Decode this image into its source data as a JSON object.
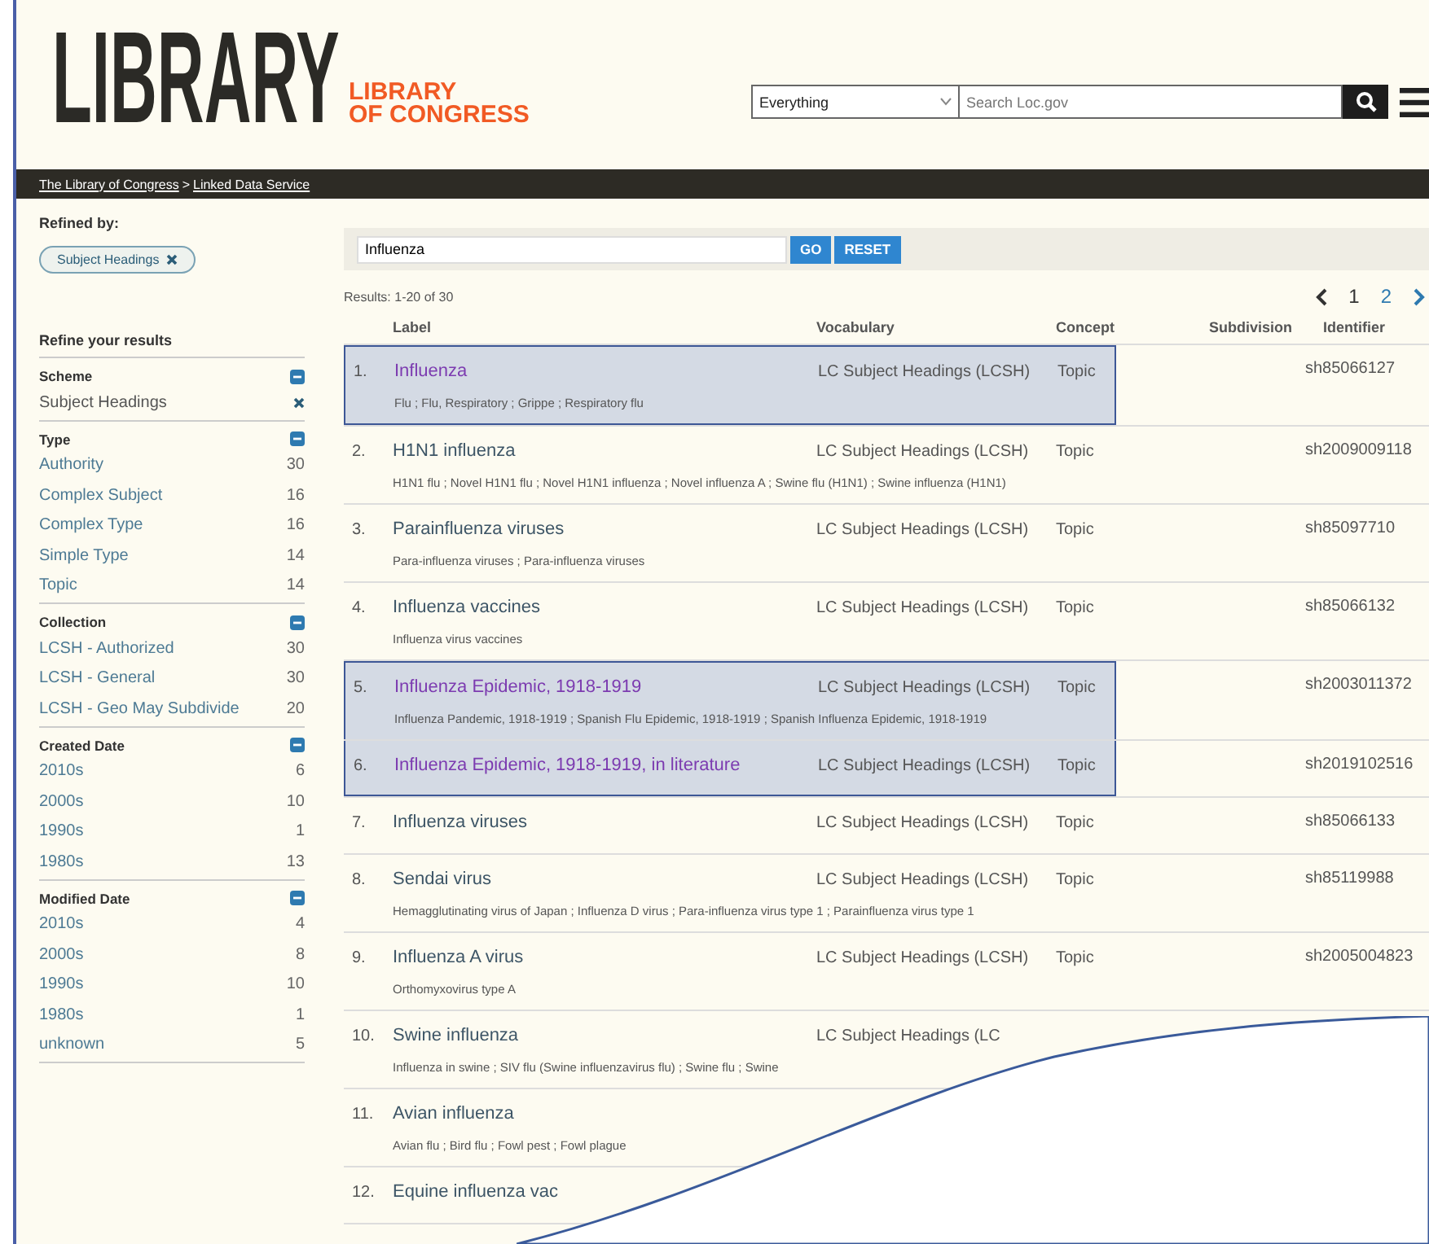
{
  "header": {
    "logo_word": "LIBRARY",
    "logo_sub": [
      "LIBRARY",
      "OF CONGRESS"
    ],
    "scope": "Everything",
    "search_placeholder": "Search Loc.gov"
  },
  "breadcrumb": [
    "The Library of Congress",
    "Linked Data Service"
  ],
  "breadcrumb_sep": ">",
  "sidebar": {
    "refined_title": "Refined by:",
    "chip": "Subject Headings",
    "refine_title": "Refine your results",
    "groups": [
      {
        "title": "Scheme",
        "expanded": true,
        "items": [
          {
            "label": "Subject Headings",
            "kind": "remove"
          }
        ]
      },
      {
        "title": "Type",
        "expanded": true,
        "items": [
          {
            "label": "Authority",
            "count": "30",
            "kind": "count"
          },
          {
            "label": "Complex Subject",
            "count": "16",
            "kind": "count"
          },
          {
            "label": "Complex Type",
            "count": "16",
            "kind": "count"
          },
          {
            "label": "Simple Type",
            "count": "14",
            "kind": "count"
          },
          {
            "label": "Topic",
            "count": "14",
            "kind": "count"
          }
        ]
      },
      {
        "title": "Collection",
        "expanded": true,
        "items": [
          {
            "label": "LCSH - Authorized",
            "count": "30",
            "kind": "count"
          },
          {
            "label": "LCSH - General",
            "count": "30",
            "kind": "count"
          },
          {
            "label": "LCSH - Geo May Subdivide",
            "count": "20",
            "kind": "count"
          }
        ]
      },
      {
        "title": "Created Date",
        "expanded": true,
        "items": [
          {
            "label": "2010s",
            "count": "6",
            "kind": "count"
          },
          {
            "label": "2000s",
            "count": "10",
            "kind": "count"
          },
          {
            "label": "1990s",
            "count": "1",
            "kind": "count"
          },
          {
            "label": "1980s",
            "count": "13",
            "kind": "count"
          }
        ]
      },
      {
        "title": "Modified Date",
        "expanded": true,
        "items": [
          {
            "label": "2010s",
            "count": "4",
            "kind": "count"
          },
          {
            "label": "2000s",
            "count": "8",
            "kind": "count"
          },
          {
            "label": "1990s",
            "count": "10",
            "kind": "count"
          },
          {
            "label": "1980s",
            "count": "1",
            "kind": "count"
          },
          {
            "label": "unknown",
            "count": "5",
            "kind": "count"
          }
        ]
      }
    ]
  },
  "query": {
    "value": "Influenza",
    "go": "GO",
    "reset": "RESET"
  },
  "results_count": "Results: 1-20 of 30",
  "pages": [
    {
      "label": "1",
      "selected": true
    },
    {
      "label": "2",
      "selected": false
    }
  ],
  "table": {
    "columns": [
      "Label",
      "Vocabulary",
      "Concept",
      "Subdivision",
      "Identifier"
    ],
    "rows": [
      {
        "num": "1.",
        "label": "Influenza",
        "vocab": "LC Subject Headings (LCSH)",
        "concept": "Topic",
        "id": "sh85066127",
        "alt": "Flu ; Flu, Respiratory ; Grippe ; Respiratory flu",
        "visited": true,
        "highlighted": true
      },
      {
        "num": "2.",
        "label": "H1N1 influenza",
        "vocab": "LC Subject Headings (LCSH)",
        "concept": "Topic",
        "id": "sh2009009118",
        "alt": "H1N1 flu ; Novel H1N1 flu ; Novel H1N1 influenza ; Novel influenza A ; Swine flu (H1N1) ; Swine influenza (H1N1)",
        "visited": false,
        "highlighted": false
      },
      {
        "num": "3.",
        "label": "Parainfluenza viruses",
        "vocab": "LC Subject Headings (LCSH)",
        "concept": "Topic",
        "id": "sh85097710",
        "alt": "Para-influenza viruses ; Para-influenza viruses",
        "visited": false,
        "highlighted": false
      },
      {
        "num": "4.",
        "label": "Influenza vaccines",
        "vocab": "LC Subject Headings (LCSH)",
        "concept": "Topic",
        "id": "sh85066132",
        "alt": "Influenza virus vaccines",
        "visited": false,
        "highlighted": false
      },
      {
        "num": "5.",
        "label": "Influenza Epidemic, 1918-1919",
        "vocab": "LC Subject Headings (LCSH)",
        "concept": "Topic",
        "id": "sh2003011372",
        "alt": "Influenza Pandemic, 1918-1919 ; Spanish Flu Epidemic, 1918-1919 ; Spanish Influenza Epidemic, 1918-1919",
        "visited": true,
        "highlighted": true
      },
      {
        "num": "6.",
        "label": "Influenza Epidemic, 1918-1919, in literature",
        "vocab": "LC Subject Headings (LCSH)",
        "concept": "Topic",
        "id": "sh2019102516",
        "visited": true,
        "highlighted": true
      },
      {
        "num": "7.",
        "label": "Influenza viruses",
        "vocab": "LC Subject Headings (LCSH)",
        "concept": "Topic",
        "id": "sh85066133",
        "visited": false,
        "highlighted": false
      },
      {
        "num": "8.",
        "label": "Sendai virus",
        "vocab": "LC Subject Headings (LCSH)",
        "concept": "Topic",
        "id": "sh85119988",
        "alt": "Hemagglutinating virus of Japan ; Influenza D virus ; Para-influenza virus type 1 ; Parainfluenza virus type 1",
        "visited": false,
        "highlighted": false
      },
      {
        "num": "9.",
        "label": "Influenza A virus",
        "vocab": "LC Subject Headings (LCSH)",
        "concept": "Topic",
        "id": "sh2005004823",
        "alt": "Orthomyxovirus type A",
        "visited": false,
        "highlighted": false
      },
      {
        "num": "10.",
        "label": "Swine influenza",
        "vocab": "LC Subject Headings (LC",
        "alt": "Influenza in swine ; SIV flu (Swine influenzavirus flu) ; Swine flu ; Swine",
        "visited": false,
        "highlighted": false
      },
      {
        "num": "11.",
        "label": "Avian influenza",
        "alt": "Avian flu ; Bird flu ; Fowl pest ; Fowl plague",
        "visited": false,
        "highlighted": false
      },
      {
        "num": "12.",
        "label": "Equine influenza vac",
        "visited": false,
        "highlighted": false
      }
    ]
  }
}
